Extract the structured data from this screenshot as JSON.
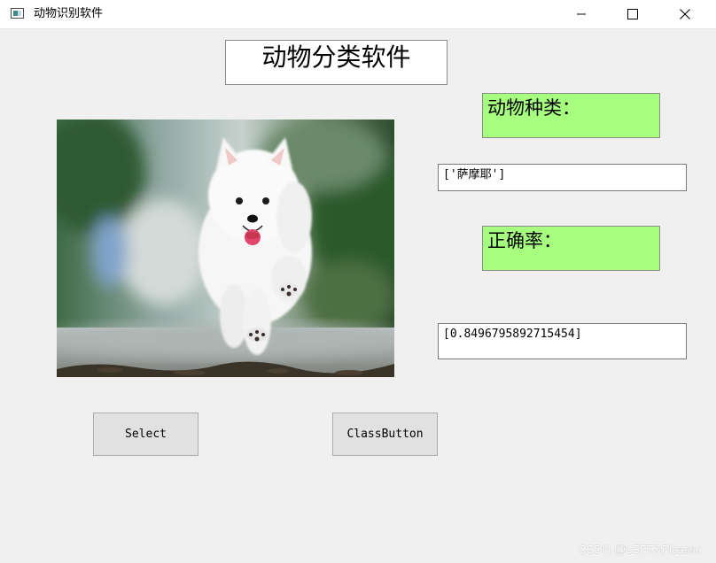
{
  "window": {
    "title": "动物识别软件",
    "icon": "app-window-icon",
    "controls": [
      "minimize-icon",
      "maximize-icon",
      "close-icon"
    ]
  },
  "header": {
    "title": "动物分类软件"
  },
  "image": {
    "subject": "white fluffy dog running on a forest path"
  },
  "labels": {
    "species": "动物种类：",
    "accuracy": "正确率："
  },
  "results": {
    "species_value": "['萨摩耶']",
    "accuracy_value": "[0.8496795892715454]"
  },
  "buttons": {
    "select_label": "Select",
    "class_label": "ClassButton"
  },
  "watermark": "CSDN @LEFT&Picasso",
  "colors": {
    "label_background": "#a7ff7f",
    "window_background": "#f0f0f0"
  }
}
